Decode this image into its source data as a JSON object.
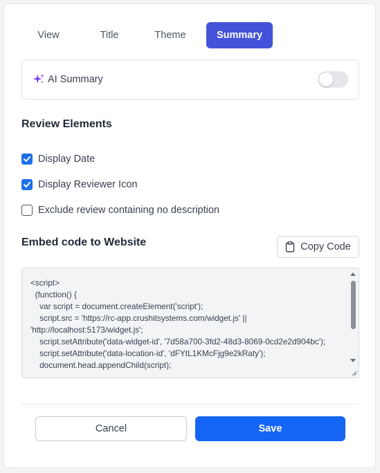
{
  "tabs": [
    {
      "label": "View",
      "active": false
    },
    {
      "label": "Title",
      "active": false
    },
    {
      "label": "Theme",
      "active": false
    },
    {
      "label": "Summary",
      "active": true
    }
  ],
  "ai_summary": {
    "label": "AI Summary",
    "enabled": false,
    "icon": "sparkles-icon"
  },
  "review_elements": {
    "title": "Review Elements",
    "options": [
      {
        "label": "Display Date",
        "checked": true
      },
      {
        "label": "Display Reviewer Icon",
        "checked": true
      },
      {
        "label": "Exclude review containing no description",
        "checked": false
      }
    ]
  },
  "embed": {
    "title": "Embed code to Website",
    "copy_label": "Copy Code",
    "copy_icon": "clipboard-icon",
    "code": "<script>\n  (function() {\n    var script = document.createElement('script');\n    script.src = 'https://rc-app.crushitsystems.com/widget.js' || 'http://localhost:5173/widget.js';\n    script.setAttribute('data-widget-id', '7d58a700-3fd2-48d3-8069-0cd2e2d904bc');\n    script.setAttribute('data-location-id', 'dFYtL1KMcFjg9e2kRaty');\n    document.head.appendChild(script);"
  },
  "actions": {
    "cancel_label": "Cancel",
    "save_label": "Save"
  },
  "colors": {
    "accent": "#4353d9",
    "primary_button": "#1565f5",
    "checkbox": "#1f6feb"
  }
}
